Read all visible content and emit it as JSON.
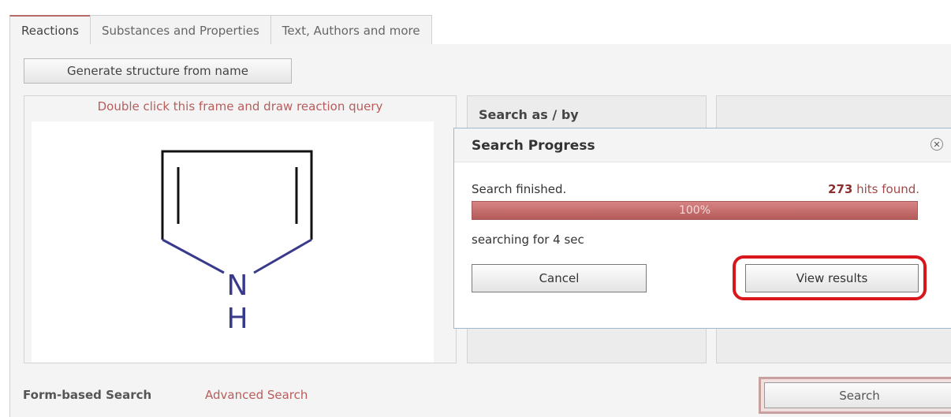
{
  "tabs": [
    {
      "label": "Reactions",
      "active": true
    },
    {
      "label": "Substances and Properties",
      "active": false
    },
    {
      "label": "Text, Authors and more",
      "active": false
    }
  ],
  "generate_button": "Generate structure from name",
  "draw_frame": {
    "hint": "Double click this frame and draw reaction query",
    "atom_symbol": "N",
    "hydrogen_symbol": "H"
  },
  "search_as": {
    "title": "Search as / by"
  },
  "dialog": {
    "title": "Search Progress",
    "close_icon": "close-circle-icon",
    "status": "Search finished.",
    "hits_count": "273",
    "hits_suffix": " hits found.",
    "progress_percent": 100,
    "progress_label": "100%",
    "duration": "searching for 4 sec",
    "cancel_label": "Cancel",
    "view_results_label": "View results"
  },
  "bottom": {
    "form_search": "Form-based Search",
    "advanced_search": "Advanced Search",
    "search_label": "Search"
  },
  "colors": {
    "accent": "#b85c5c",
    "progress": "#c06868",
    "highlight": "#d8161c",
    "atom": "#3a3a8c"
  }
}
